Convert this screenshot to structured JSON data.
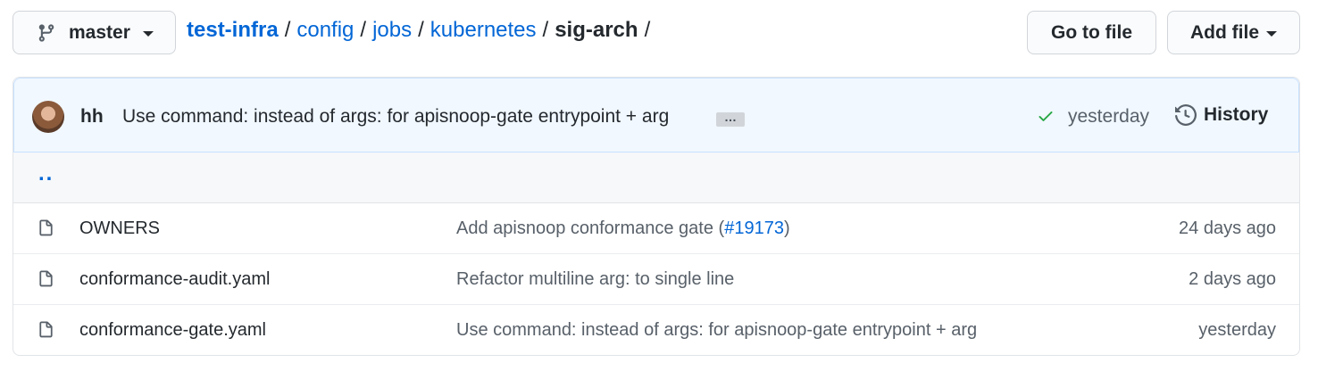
{
  "branch": {
    "name": "master",
    "icon": "git-branch-icon"
  },
  "breadcrumb": {
    "root": "test-infra",
    "separator": "/",
    "segments": [
      "config",
      "jobs",
      "kubernetes"
    ],
    "current": "sig-arch",
    "trailing": "/"
  },
  "actions": {
    "goto_label": "Go to file",
    "addfile_label": "Add file"
  },
  "latest_commit": {
    "author": "hh",
    "message": "Use command: instead of args: for apisnoop-gate entrypoint + arg",
    "ellipsis": "…",
    "status": "success",
    "status_color": "#28a745",
    "time": "yesterday",
    "history_label": "History"
  },
  "parent_dir": "..",
  "files": [
    {
      "name": "OWNERS",
      "commit_prefix": "Add apisnoop conformance gate (",
      "commit_link": "#19173",
      "commit_suffix": ")",
      "age": "24 days ago"
    },
    {
      "name": "conformance-audit.yaml",
      "commit_prefix": "Refactor multiline arg: to single line",
      "commit_link": "",
      "commit_suffix": "",
      "age": "2 days ago"
    },
    {
      "name": "conformance-gate.yaml",
      "commit_prefix": "Use command: instead of args: for apisnoop-gate entrypoint + arg",
      "commit_link": "",
      "commit_suffix": "",
      "age": "yesterday"
    }
  ],
  "colors": {
    "link": "#0366d6",
    "commit_bar_bg": "#f1f8ff",
    "commit_bar_border": "#c8e1ff"
  }
}
